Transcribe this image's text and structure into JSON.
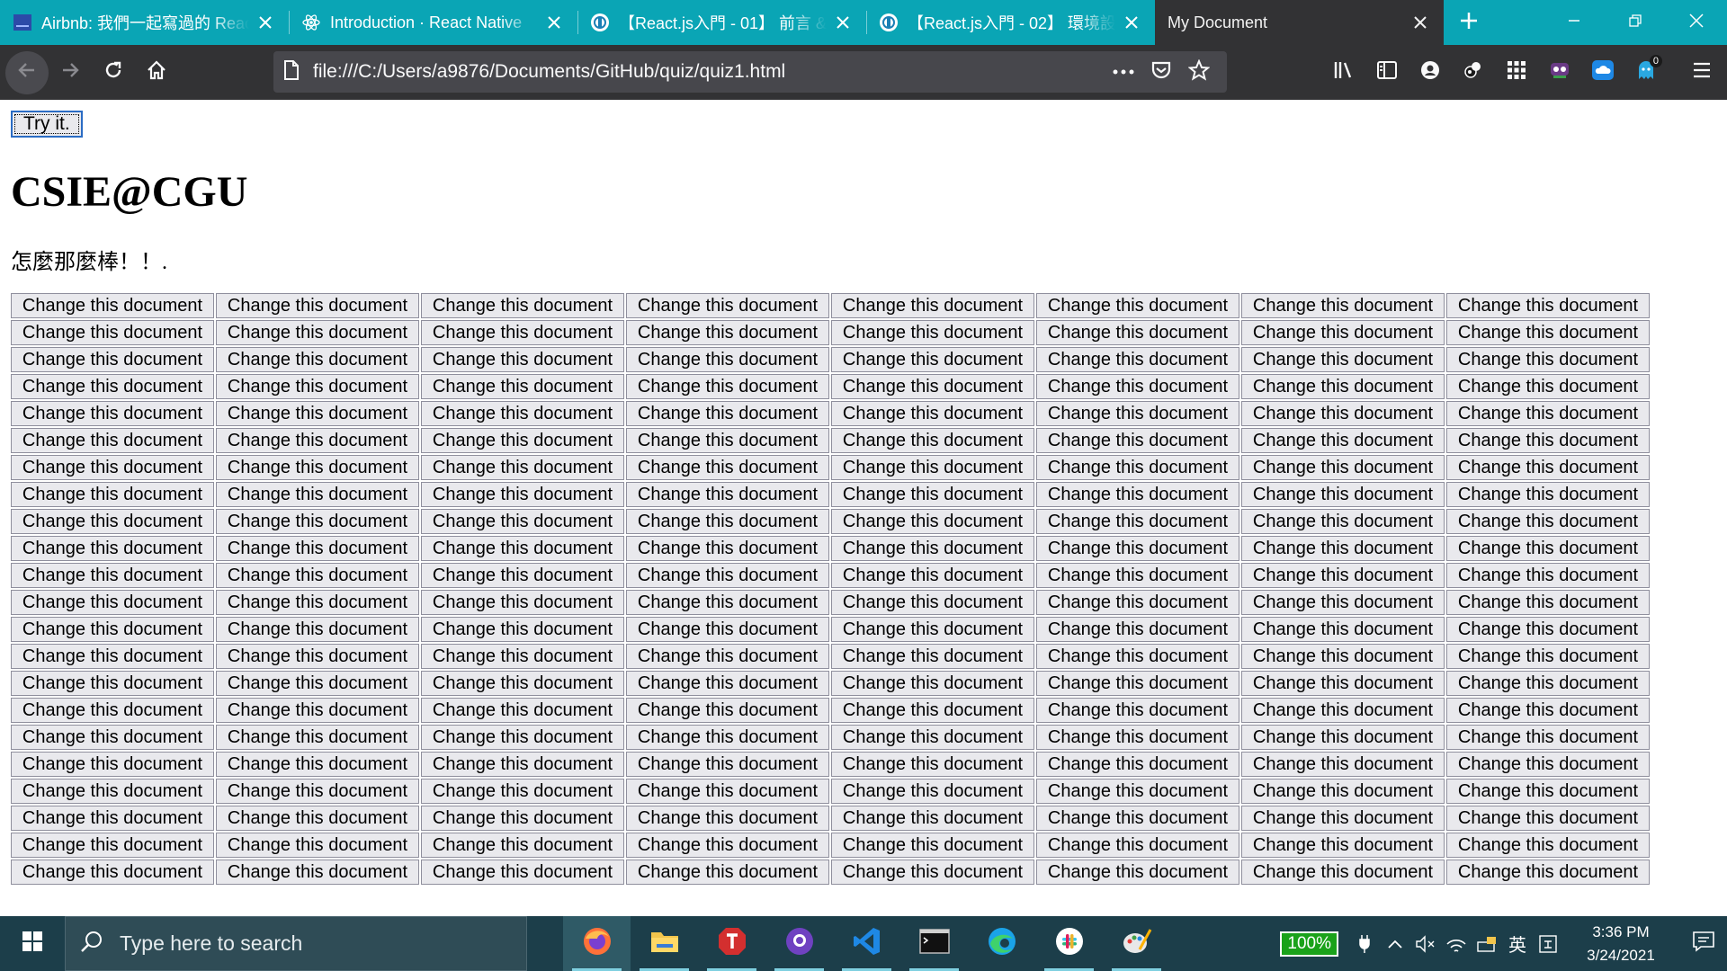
{
  "browser": {
    "tabs": [
      {
        "title": "Airbnb: 我們一起寫過的 React",
        "favicon": "airbnb-doc-icon",
        "active": false
      },
      {
        "title": "Introduction · React Native",
        "favicon": "react-icon",
        "active": false
      },
      {
        "title": "【React.js入門 - 01】 前言 &",
        "favicon": "ithome-icon",
        "active": false
      },
      {
        "title": "【React.js入門 - 02】 環境設定",
        "favicon": "ithome-icon",
        "active": false
      },
      {
        "title": "My Document",
        "favicon": "",
        "active": true
      }
    ],
    "url": "file:///C:/Users/a9876/Documents/GitHub/quiz/quiz1.html",
    "badge_count": "0",
    "colors": {
      "tabstrip": "#0aa5b5",
      "toolbar": "#323234",
      "urlbar": "#47474c"
    }
  },
  "page": {
    "try_button": "Try it.",
    "heading": "CSIE@CGU",
    "paragraph": "怎麼那麼棒！！.",
    "grid_button_label": "Change this document",
    "grid_rows": 22,
    "grid_cols": 8
  },
  "taskbar": {
    "search_placeholder": "Type here to search",
    "pins": [
      "firefox-icon",
      "file-explorer-icon",
      "t-app-icon",
      "github-desktop-icon",
      "vscode-icon",
      "terminal-icon",
      "edge-icon",
      "slack-icon",
      "paint-icon"
    ],
    "battery_percent": "100%",
    "ime": "英",
    "time": "3:36 PM",
    "date": "3/24/2021"
  }
}
